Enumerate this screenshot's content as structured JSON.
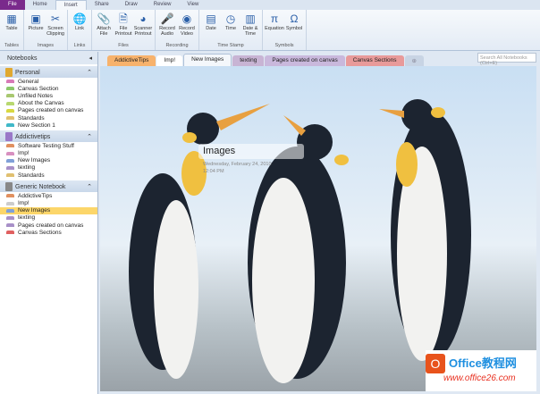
{
  "ribbon_tabs": [
    "File",
    "Home",
    "Insert",
    "Share",
    "Draw",
    "Review",
    "View"
  ],
  "ribbon_groups": [
    {
      "label": "Tables",
      "buttons": [
        {
          "label": "Table",
          "icon": "table-icon"
        }
      ]
    },
    {
      "label": "Images",
      "buttons": [
        {
          "label": "Picture",
          "icon": "picture-icon"
        },
        {
          "label": "Screen Clipping",
          "icon": "screen-clipping-icon"
        }
      ]
    },
    {
      "label": "Links",
      "buttons": [
        {
          "label": "Link",
          "icon": "link-icon"
        }
      ]
    },
    {
      "label": "Files",
      "buttons": [
        {
          "label": "Attach File",
          "icon": "attach-icon"
        },
        {
          "label": "File Printout",
          "icon": "file-printout-icon"
        },
        {
          "label": "Scanner Printout",
          "icon": "scanner-icon"
        }
      ]
    },
    {
      "label": "Recording",
      "buttons": [
        {
          "label": "Record Audio",
          "icon": "microphone-icon"
        },
        {
          "label": "Record Video",
          "icon": "video-camera-icon"
        }
      ]
    },
    {
      "label": "Time Stamp",
      "buttons": [
        {
          "label": "Date",
          "icon": "calendar-icon"
        },
        {
          "label": "Time",
          "icon": "clock-icon"
        },
        {
          "label": "Date & Time",
          "icon": "date-time-icon"
        }
      ]
    },
    {
      "label": "Symbols",
      "buttons": [
        {
          "label": "Equation",
          "icon": "pi-icon"
        },
        {
          "label": "Symbol",
          "icon": "omega-icon"
        }
      ]
    }
  ],
  "section_tabs": [
    {
      "label": "AddictiveTips",
      "color": "#f7b26c"
    },
    {
      "label": "Imp!",
      "color": "#ffffff"
    },
    {
      "label": "New Images",
      "color": "#f4f7fb"
    },
    {
      "label": "texting",
      "color": "#c8b4d4"
    },
    {
      "label": "Pages created on canvas",
      "color": "#c9b8dc"
    },
    {
      "label": "Canvas Sections",
      "color": "#e89a9a"
    }
  ],
  "search_placeholder": "Search All Notebooks (Ctrl+E)",
  "sidebar": {
    "header": "Notebooks",
    "notebooks": [
      {
        "name": "Personal",
        "color": "#e0a830",
        "sections": [
          {
            "label": "General",
            "color": "#d87ab8"
          },
          {
            "label": "Canvas Section",
            "color": "#8cc86c"
          },
          {
            "label": "Unfiled Notes",
            "color": "#a8c870"
          },
          {
            "label": "About the Canvas",
            "color": "#b8d870"
          },
          {
            "label": "Pages created on canvas",
            "color": "#d8d840"
          },
          {
            "label": "Standards",
            "color": "#e0c070"
          },
          {
            "label": "New Section 1",
            "color": "#40b8c8"
          }
        ]
      },
      {
        "name": "Addictivetips",
        "color": "#9a78c8",
        "sections": [
          {
            "label": "Software Testing Stuff",
            "color": "#e09060"
          },
          {
            "label": "Imp!",
            "color": "#d890c0"
          },
          {
            "label": "New Images",
            "color": "#80a0d8"
          },
          {
            "label": "texting",
            "color": "#a890c8"
          },
          {
            "label": "Standards",
            "color": "#e0c070"
          }
        ]
      },
      {
        "name": "Generic Notebook",
        "color": "#888888",
        "sections": [
          {
            "label": "AddictiveTips",
            "color": "#e09060"
          },
          {
            "label": "Imp!",
            "color": "#cccccc"
          },
          {
            "label": "New Images",
            "color": "#80a0d8",
            "selected": true
          },
          {
            "label": "texting",
            "color": "#a890c8"
          },
          {
            "label": "Pages created on canvas",
            "color": "#a890c8"
          },
          {
            "label": "Canvas Sections",
            "color": "#e06060"
          }
        ]
      }
    ]
  },
  "page": {
    "title": "Images",
    "date": "Wednesday, February 24, 2010",
    "time": "12:04 PM"
  },
  "watermark": {
    "text": "Office教程网",
    "url": "www.office26.com"
  }
}
